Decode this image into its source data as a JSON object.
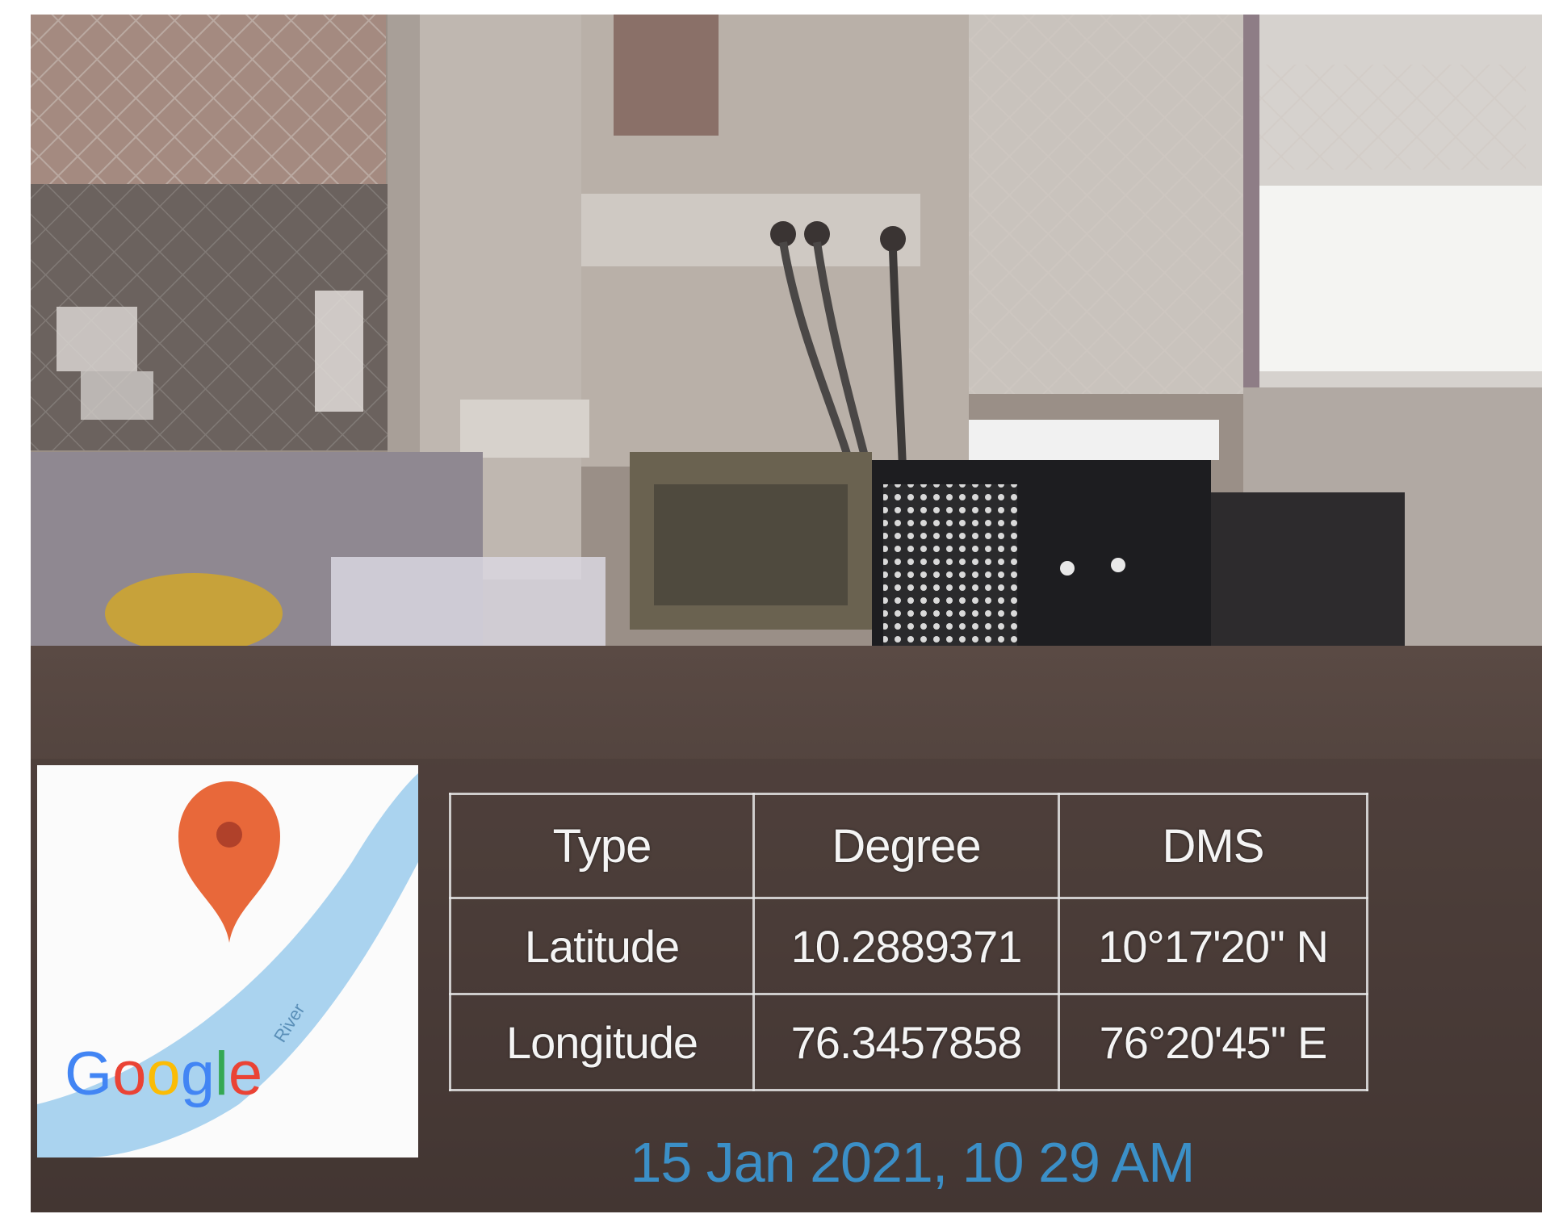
{
  "map_thumbnail": {
    "logo_text": "Google",
    "pin_color": "#e8683a",
    "water_color": "#aad3ef",
    "river_label": "River"
  },
  "coordinates_table": {
    "headers": [
      "Type",
      "Degree",
      "DMS"
    ],
    "rows": [
      {
        "type": "Latitude",
        "degree": "10.2889371",
        "dms": "10°17'20\" N"
      },
      {
        "type": "Longitude",
        "degree": "76.3457858",
        "dms": "76°20'45\" E"
      }
    ]
  },
  "timestamp": "15 Jan 2021, 10 29 AM",
  "colors": {
    "timestamp": "#3b8fc7"
  }
}
